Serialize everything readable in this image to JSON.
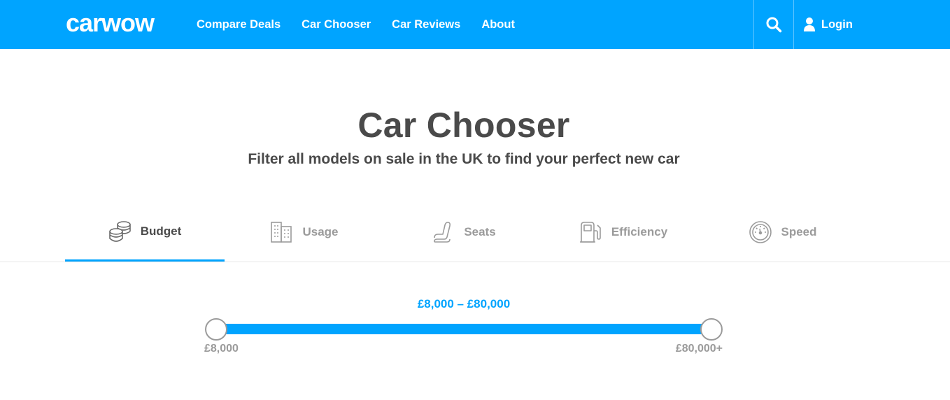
{
  "header": {
    "logo_text": "carwow",
    "nav": [
      "Compare Deals",
      "Car Chooser",
      "Car Reviews",
      "About"
    ],
    "login_label": "Login",
    "search_icon": "search-icon",
    "user_icon": "user-icon"
  },
  "hero": {
    "title": "Car Chooser",
    "subtitle": "Filter all models on sale in the UK to find your perfect new car"
  },
  "tabs": [
    {
      "label": "Budget",
      "icon": "coins-icon",
      "active": true
    },
    {
      "label": "Usage",
      "icon": "building-icon",
      "active": false
    },
    {
      "label": "Seats",
      "icon": "seat-icon",
      "active": false
    },
    {
      "label": "Efficiency",
      "icon": "fuel-pump-icon",
      "active": false
    },
    {
      "label": "Speed",
      "icon": "speedometer-icon",
      "active": false
    }
  ],
  "budget": {
    "range_label": "£8,000 – £80,000",
    "min_label": "£8,000",
    "max_label": "£80,000+",
    "selected_min_fraction": 0,
    "selected_max_fraction": 1
  },
  "colors": {
    "brand": "#00a4ff",
    "text_dark": "#4a4a4a",
    "text_muted": "#9b9b9b"
  }
}
